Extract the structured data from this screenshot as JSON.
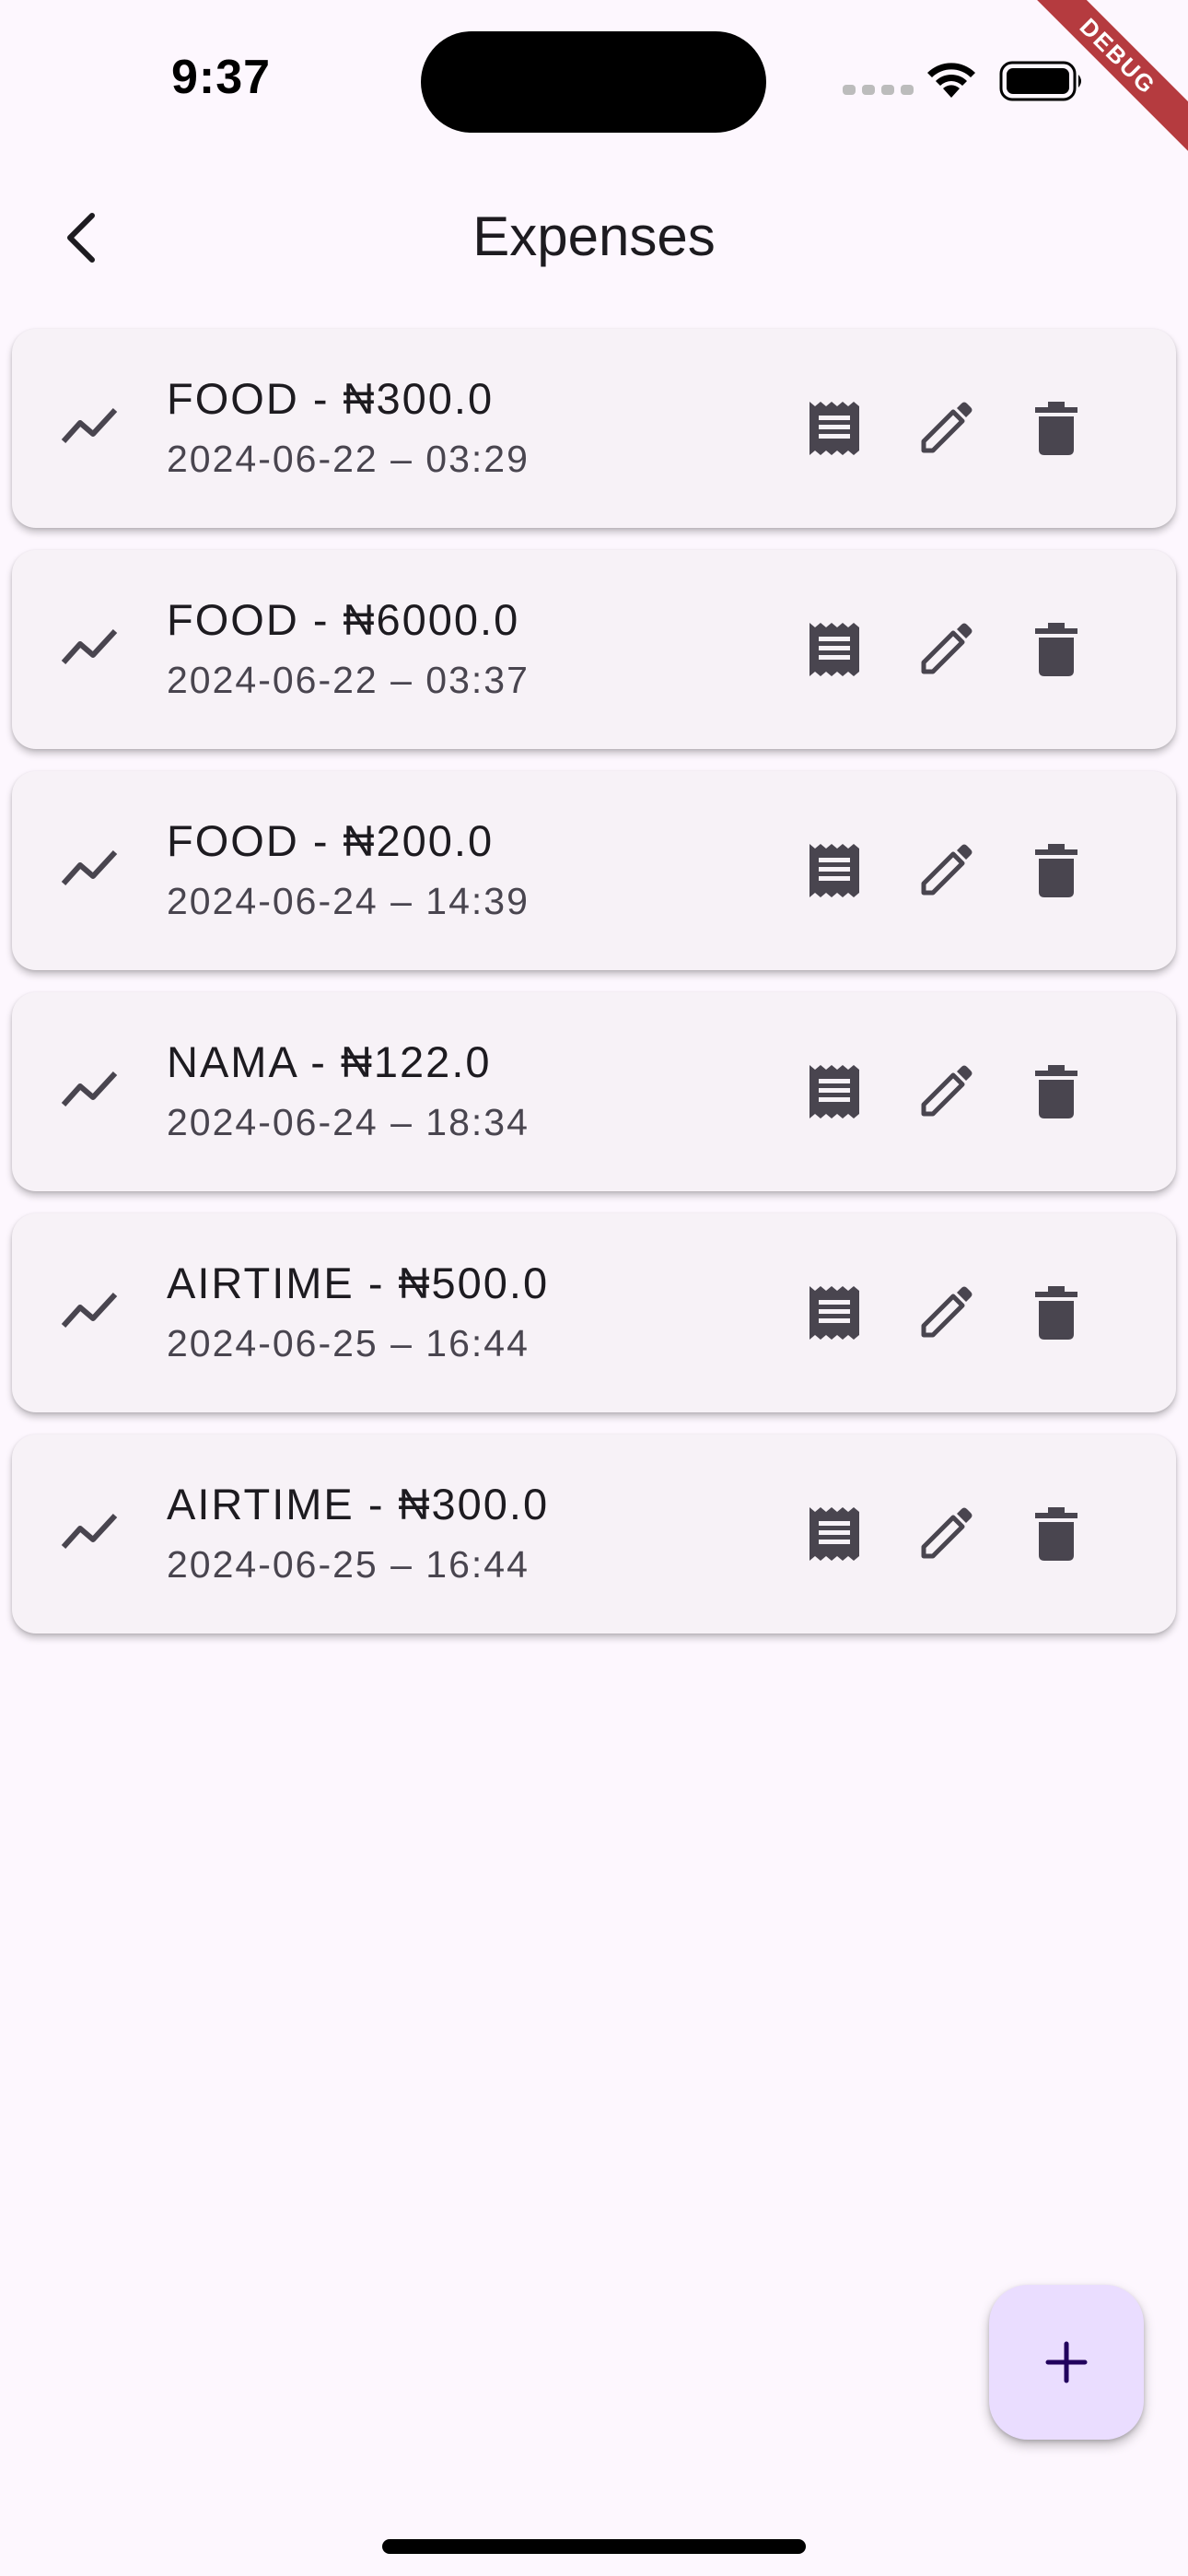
{
  "status_bar": {
    "time": "9:37",
    "debug_label": "DEBUG"
  },
  "app_bar": {
    "title": "Expenses",
    "back_icon": "chevron-left-icon"
  },
  "expenses": [
    {
      "title": "FOOD - ₦300.0",
      "date": "2024-06-22 – 03:29"
    },
    {
      "title": "FOOD - ₦6000.0",
      "date": "2024-06-22 – 03:37"
    },
    {
      "title": "FOOD - ₦200.0",
      "date": "2024-06-24 – 14:39"
    },
    {
      "title": "NAMA - ₦122.0",
      "date": "2024-06-24 – 18:34"
    },
    {
      "title": "AIRTIME - ₦500.0",
      "date": "2024-06-25 – 16:44"
    },
    {
      "title": "AIRTIME - ₦300.0",
      "date": "2024-06-25 – 16:44"
    }
  ],
  "row_icons": {
    "leading": "trending-up-icon",
    "receipt": "receipt-icon",
    "edit": "pencil-icon",
    "delete": "trash-icon"
  },
  "fab": {
    "icon": "plus-icon"
  },
  "colors": {
    "background": "#fdf7fe",
    "card": "#f7f2f7",
    "icon": "#49454f",
    "fab": "#eaddff",
    "fab_icon": "#21005d",
    "debug_ribbon": "#b53b3f"
  }
}
